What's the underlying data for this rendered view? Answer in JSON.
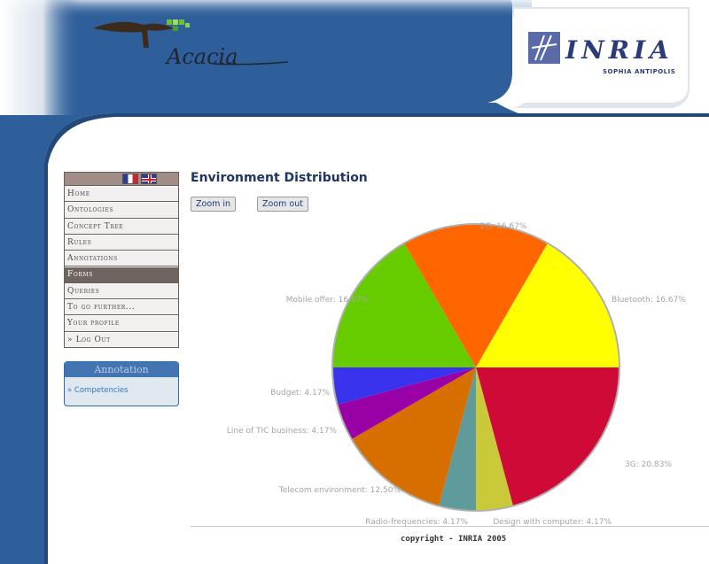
{
  "header": {
    "logo_left_text": "Acacia",
    "logo_right_text": "INRIA",
    "logo_right_subtext": "SOPHIA ANTIPOLIS"
  },
  "sidebar": {
    "flags": [
      "french-flag-icon",
      "uk-flag-icon"
    ],
    "menu": [
      {
        "label": "Home"
      },
      {
        "label": "Ontologies"
      },
      {
        "label": "Concept Tree"
      },
      {
        "label": "Rules"
      },
      {
        "label": "Annotations"
      },
      {
        "label": "Forms",
        "active": true
      },
      {
        "label": "Queries"
      },
      {
        "label": "To go further..."
      },
      {
        "label": "Your profile"
      },
      {
        "label": "» Log Out"
      }
    ],
    "annotation": {
      "title": "Annotation",
      "link": "» Competencies"
    }
  },
  "main": {
    "title": "Environment Distribution",
    "zoom_in": "Zoom in",
    "zoom_out": "Zoom out"
  },
  "chart_data": {
    "type": "pie",
    "slices": [
      {
        "label": "3G: 20.83%",
        "value": 20.83,
        "color": "#cf0a37"
      },
      {
        "label": "Design with computer: 4.17%",
        "value": 4.17,
        "color": "#c9c93a"
      },
      {
        "label": "Radio-frequencies: 4.17%",
        "value": 4.17,
        "color": "#5f9b9a"
      },
      {
        "label": "Telecom environment: 12.50%",
        "value": 12.5,
        "color": "#d76f00"
      },
      {
        "label": "Line of TIC business: 4.17%",
        "value": 4.17,
        "color": "#9900a6"
      },
      {
        "label": "Budget: 4.17%",
        "value": 4.17,
        "color": "#3a33ee"
      },
      {
        "label": "Mobile offer: 16.67%",
        "value": 16.67,
        "color": "#66cc00"
      },
      {
        "label": "2G: 16.67%",
        "value": 16.67,
        "color": "#ff6600"
      },
      {
        "label": "Bluetooth: 16.67%",
        "value": 16.67,
        "color": "#ffff00"
      }
    ]
  },
  "footer": {
    "copyright": "copyright - INRIA 2005"
  }
}
